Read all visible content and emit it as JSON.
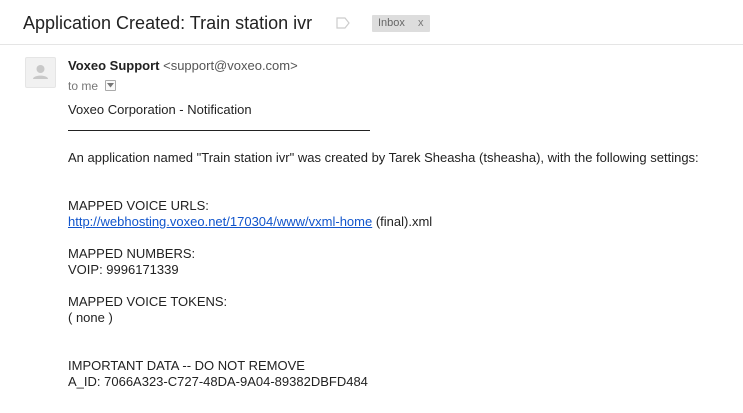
{
  "header": {
    "subject": "Application Created: Train station ivr",
    "label_chip": "Inbox",
    "label_remove": "x",
    "icons": [
      "label-tag-icon",
      "avatar-person-icon",
      "chevron-down-icon"
    ]
  },
  "message": {
    "sender_name": "Voxeo Support",
    "sender_email": "<support@voxeo.com>",
    "recipient": "to me",
    "body": {
      "notification_title": "Voxeo Corporation - Notification",
      "intro": "An application named \"Train station ivr\" was created by Tarek Sheasha (tsheasha), with the following settings:",
      "voice_urls_heading": "MAPPED VOICE URLS:",
      "voice_url_link": "http://webhosting.voxeo.net/170304/www/vxml-home",
      "voice_url_suffix": " (final).xml",
      "numbers_heading": "MAPPED NUMBERS:",
      "voip_number": "VOIP: 9996171339",
      "tokens_heading": "MAPPED VOICE TOKENS:",
      "tokens_value": "( none )",
      "important_heading": "IMPORTANT DATA -- DO NOT REMOVE",
      "app_id": "A_ID: 7066A323-C727-48DA-9A04-89382DBFD484"
    }
  },
  "colors": {
    "link": "#1155cc",
    "text": "#222222",
    "chip_bg": "#dddddd",
    "muted": "#777777"
  }
}
